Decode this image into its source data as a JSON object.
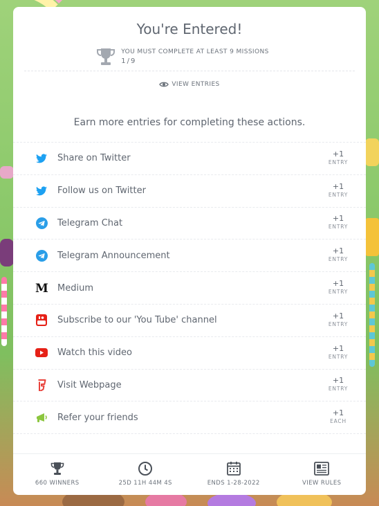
{
  "header": {
    "title": "You're Entered!",
    "mission_text": "YOU MUST COMPLETE AT LEAST 9 MISSIONS",
    "mission_progress": "1/9"
  },
  "view_entries_label": "VIEW ENTRIES",
  "subtitle": "Earn more entries for completing these actions.",
  "actions": [
    {
      "label": "Share on Twitter",
      "points": "+1",
      "unit": "ENTRY",
      "icon": "twitter-icon"
    },
    {
      "label": "Follow us on Twitter",
      "points": "+1",
      "unit": "ENTRY",
      "icon": "twitter-icon"
    },
    {
      "label": "Telegram Chat",
      "points": "+1",
      "unit": "ENTRY",
      "icon": "telegram-icon"
    },
    {
      "label": "Telegram Announcement",
      "points": "+1",
      "unit": "ENTRY",
      "icon": "telegram-icon"
    },
    {
      "label": "Medium",
      "points": "+1",
      "unit": "ENTRY",
      "icon": "medium-icon"
    },
    {
      "label": "Subscribe to our 'You Tube' channel",
      "points": "+1",
      "unit": "ENTRY",
      "icon": "youtube-logo-icon"
    },
    {
      "label": "Watch this video",
      "points": "+1",
      "unit": "ENTRY",
      "icon": "youtube-play-icon"
    },
    {
      "label": "Visit Webpage",
      "points": "+1",
      "unit": "ENTRY",
      "icon": "foursquare-icon"
    },
    {
      "label": "Refer your friends",
      "points": "+1",
      "unit": "EACH",
      "icon": "megaphone-icon"
    }
  ],
  "footer": {
    "winners": "660 WINNERS",
    "countdown": "25D 11H 44M 4S",
    "ends": "ENDS 1-28-2022",
    "rules": "VIEW RULES"
  },
  "colors": {
    "twitter": "#1da1f2",
    "telegram": "#2a9ee8",
    "youtube": "#e62117",
    "foursquare": "#e8423b",
    "megaphone": "#8cc63f",
    "text": "#5f6670"
  }
}
